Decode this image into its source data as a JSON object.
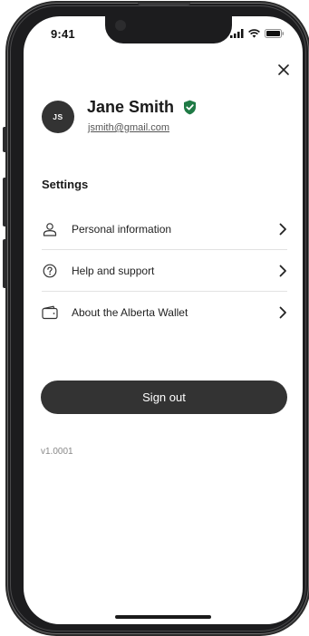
{
  "status_bar": {
    "time": "9:41",
    "icons": [
      "signal-icon",
      "wifi-icon",
      "battery-icon"
    ]
  },
  "close_icon": "close-icon",
  "profile": {
    "initials": "JS",
    "name": "Jane Smith",
    "email": "jsmith@gmail.com",
    "verified_icon": "verified-shield-icon",
    "verified_color": "#1f7a45"
  },
  "settings": {
    "heading": "Settings",
    "items": [
      {
        "label": "Personal information",
        "icon": "person-icon"
      },
      {
        "label": "Help and support",
        "icon": "help-icon"
      },
      {
        "label": "About the Alberta Wallet",
        "icon": "wallet-icon"
      }
    ]
  },
  "sign_out": {
    "label": "Sign out",
    "color": "#333333"
  },
  "version": "v1.0001"
}
